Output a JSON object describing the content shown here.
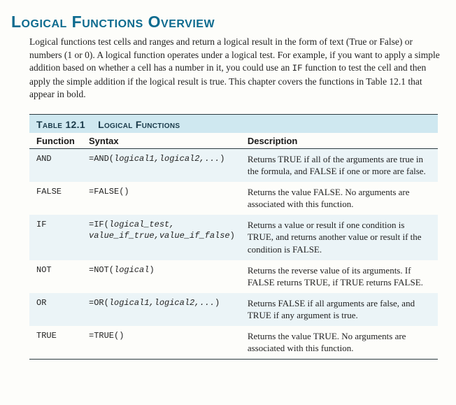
{
  "title": "Logical Functions Overview",
  "intro": {
    "p1a": "Logical functions test cells and ranges and return a logical result in the form of text (True or False) or numbers (1 or 0). A logical function operates under a logical test. For example, if you want to apply a simple addition based on whether a cell has a number in it, you could use an ",
    "code": "IF",
    "p1b": " function to test the cell and then apply the simple addition if the logical result is true. This chapter covers the functions in Table 12.1 that appear in bold."
  },
  "table": {
    "caption_label": "Table 12.1",
    "caption_text": "Logical Functions",
    "headers": {
      "c1": "Function",
      "c2": "Syntax",
      "c3": "Description"
    },
    "rows": [
      {
        "fn": "AND",
        "syntax_prefix": "=AND(",
        "syntax_args": "logical1,logical2,...",
        "syntax_suffix": ")",
        "desc": "Returns TRUE if all of the arguments are true in the formula, and FALSE if one or more are false."
      },
      {
        "fn": "FALSE",
        "syntax_prefix": "=FALSE()",
        "syntax_args": "",
        "syntax_suffix": "",
        "desc": "Returns the value FALSE. No arguments are associated with this function."
      },
      {
        "fn": "IF",
        "syntax_prefix": "=IF(",
        "syntax_args": "logical_test, value_if_true,value_if_false",
        "syntax_suffix": ")",
        "desc": "Returns a value or result if one condition is TRUE, and returns another value or result if the condition is FALSE."
      },
      {
        "fn": "NOT",
        "syntax_prefix": "=NOT(",
        "syntax_args": "logical",
        "syntax_suffix": ")",
        "desc": "Returns the reverse value of its arguments. If FALSE returns TRUE, if TRUE returns FALSE."
      },
      {
        "fn": "OR",
        "syntax_prefix": "=OR(",
        "syntax_args": "logical1,logical2,...",
        "syntax_suffix": ")",
        "desc": "Returns FALSE if all arguments are false, and TRUE if any argument is true."
      },
      {
        "fn": "TRUE",
        "syntax_prefix": "=TRUE()",
        "syntax_args": "",
        "syntax_suffix": "",
        "desc": "Returns the value TRUE. No arguments are associated with this function."
      }
    ]
  }
}
